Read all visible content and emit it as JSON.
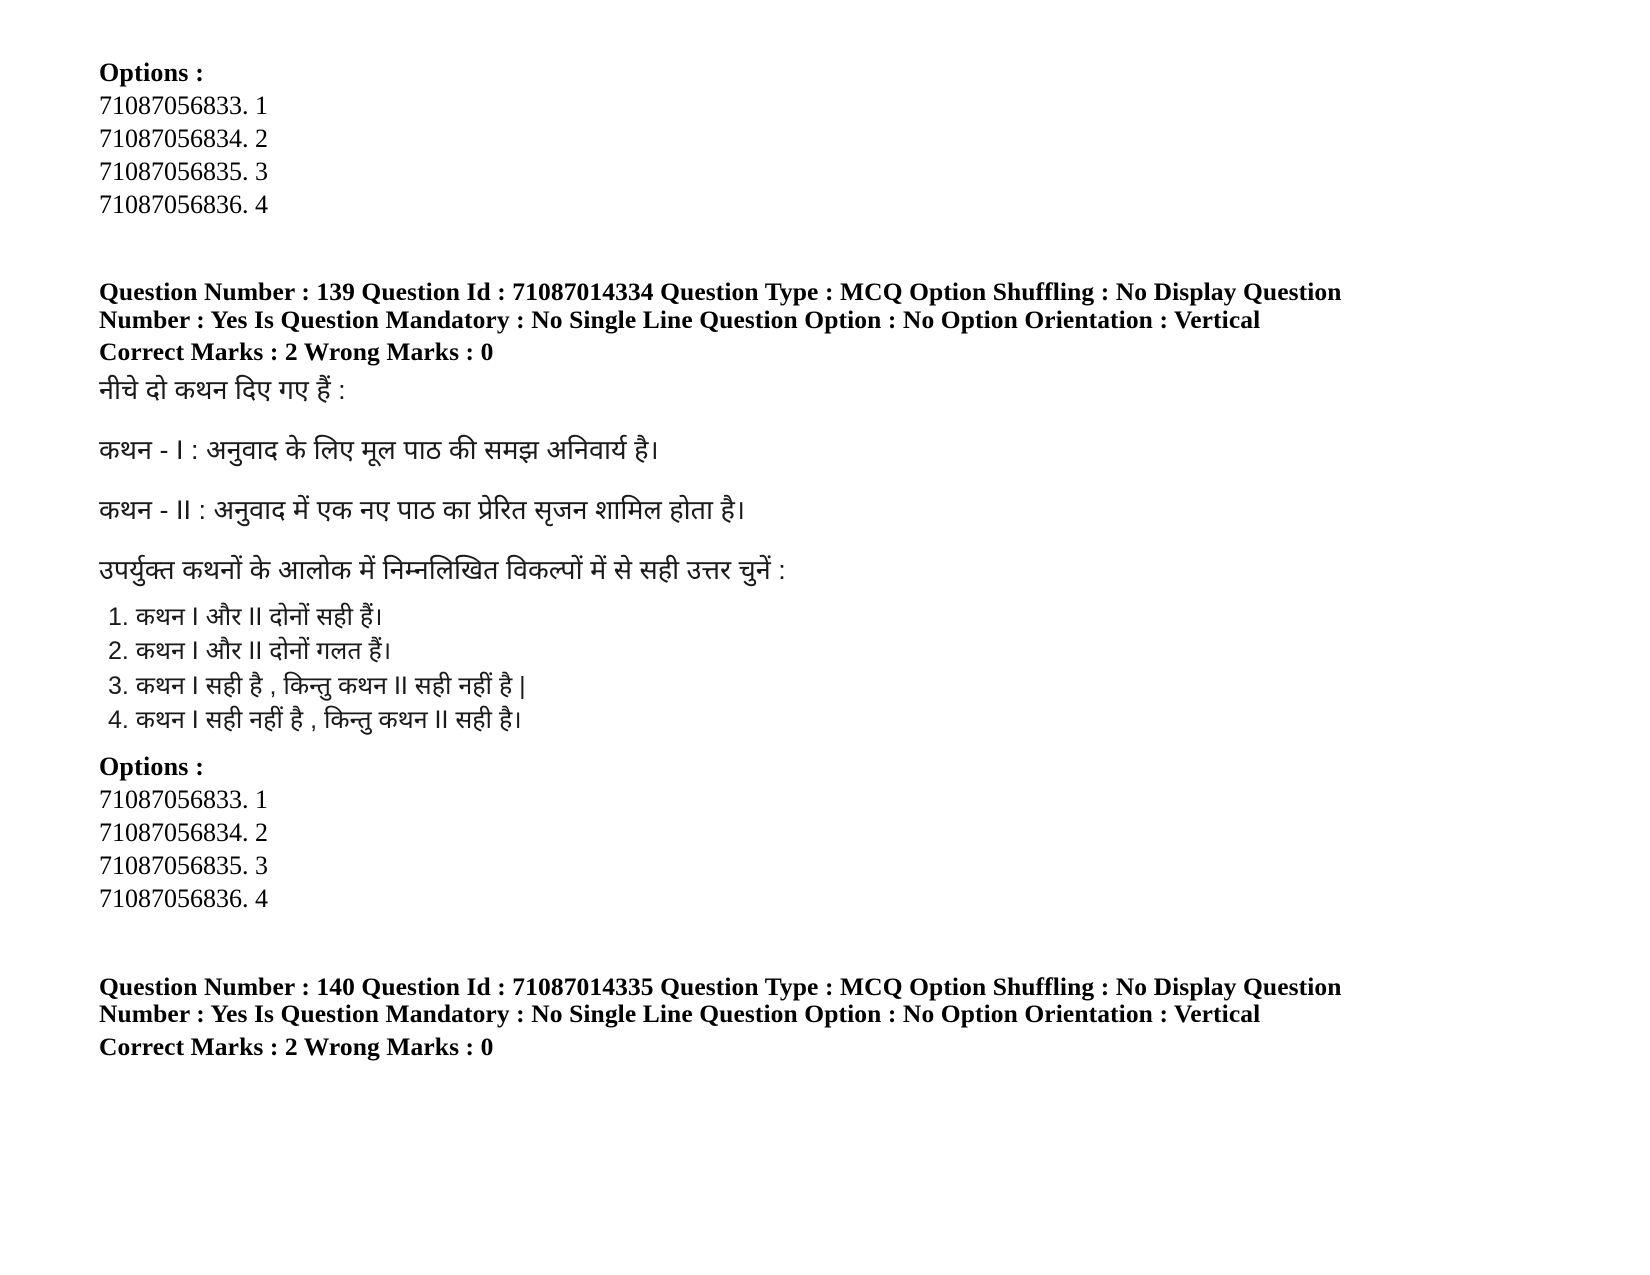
{
  "document": {
    "top_options_block": {
      "heading": "Options :",
      "items": [
        "71087056833. 1",
        "71087056834. 2",
        "71087056835. 3",
        "71087056836. 4"
      ]
    },
    "question_139": {
      "meta_line_1": "Question Number : 139 Question Id : 71087014334 Question Type : MCQ Option Shuffling : No Display Question Number : Yes Is Question Mandatory : No Single Line Question Option : No Option Orientation : Vertical",
      "meta_line_2": "Correct Marks : 2 Wrong Marks : 0",
      "stem": "नीचे दो कथन दिए गए हैं :",
      "statement_1": "कथन - I : अनुवाद के लिए मूल पाठ की समझ अनिवार्य है।",
      "statement_2": "कथन - II : अनुवाद में एक नए पाठ का प्रेरित सृजन शामिल होता है।",
      "instruction": "उपर्युक्त कथनों के आलोक में निम्नलिखित विकल्पों में से सही उत्तर चुनें :",
      "choices": [
        "1. कथन I और II दोनों सही हैं।",
        "2. कथन I और II दोनों गलत हैं।",
        "3. कथन I सही है , किन्तु कथन II सही नहीं है |",
        "4. कथन I सही नहीं है , किन्तु कथन II सही है।"
      ],
      "options_block": {
        "heading": "Options :",
        "items": [
          "71087056833. 1",
          "71087056834. 2",
          "71087056835. 3",
          "71087056836. 4"
        ]
      }
    },
    "question_140": {
      "meta_line_1": "Question Number : 140 Question Id : 71087014335 Question Type : MCQ Option Shuffling : No Display Question Number : Yes Is Question Mandatory : No Single Line Question Option : No Option Orientation : Vertical",
      "meta_line_2": "Correct Marks : 2 Wrong Marks : 0"
    }
  }
}
